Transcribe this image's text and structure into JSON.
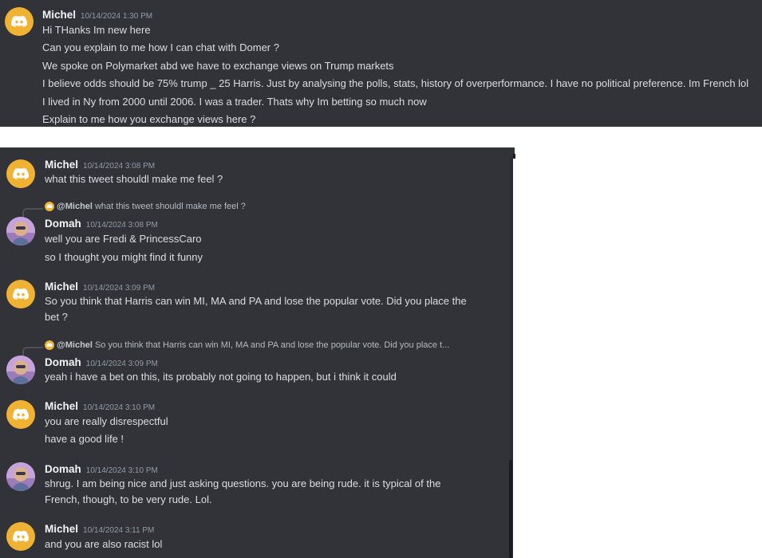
{
  "colors": {
    "background": "#313338",
    "username": "#f2f3f5",
    "message_text": "#dbdee1",
    "timestamp": "#949ba4",
    "discord_avatar": "#f0b232"
  },
  "icons": {
    "default_avatar": "discord-logo-icon",
    "user_avatar": "profile-photo"
  },
  "top_screenshot": {
    "author": "Michel",
    "timestamp": "10/14/2024 1:30 PM",
    "lines": [
      "Hi THanks Im new here",
      "Can you explain to me how I can chat with Domer ?",
      "We spoke on Polymarket abd we have to exchange views on Trump markets",
      "I believe odds should be 75% trump _ 25 Harris. Just by analysing the polls, stats, history of overperformance. I have no political preference. Im French lol",
      "I lived in Ny from 2000 until 2006. I was a trader. Thats why Im betting so much now",
      "Explain to me how you exchange views here ?"
    ]
  },
  "bottom_screenshot": {
    "messages": [
      {
        "author": "Michel",
        "timestamp": "10/14/2024 3:08 PM",
        "lines": [
          "what this tweet shouldl make me feel ?"
        ]
      },
      {
        "author": "Domah",
        "timestamp": "10/14/2024 3:08 PM",
        "reply_to": {
          "user": "@Michel",
          "text": "what this tweet shouldl make me feel ?"
        },
        "lines": [
          "well you are Fredi & PrincessCaro",
          "so I thought you might find it funny"
        ]
      },
      {
        "author": "Michel",
        "timestamp": "10/14/2024 3:09 PM",
        "lines": [
          "So you think that Harris can win MI, MA and PA and lose the popular vote. Did you place the bet ?"
        ]
      },
      {
        "author": "Domah",
        "timestamp": "10/14/2024 3:09 PM",
        "reply_to": {
          "user": "@Michel",
          "text": "So you think that Harris can win MI, MA and PA and lose the popular vote. Did you place t..."
        },
        "lines": [
          "yeah i have a bet on this, its probably not going to happen, but i think it could"
        ]
      },
      {
        "author": "Michel",
        "timestamp": "10/14/2024 3:10 PM",
        "lines": [
          "you are really disrespectful",
          "have a good life !"
        ]
      },
      {
        "author": "Domah",
        "timestamp": "10/14/2024 3:10 PM",
        "lines": [
          "shrug. I am being nice and just asking questions. you are being rude. it is typical of the French, though, to be very rude. Lol."
        ]
      },
      {
        "author": "Michel",
        "timestamp": "10/14/2024 3:11 PM",
        "lines": [
          "and you are also racist lol"
        ]
      }
    ]
  }
}
